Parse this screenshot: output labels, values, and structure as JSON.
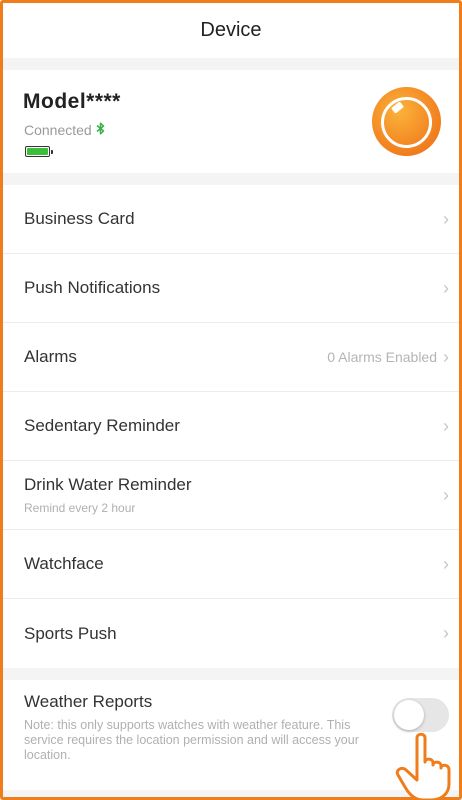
{
  "navbar": {
    "title": "Device"
  },
  "device": {
    "model": "Model****",
    "status": "Connected",
    "bluetooth_icon": "bluetooth-icon",
    "battery_level": 1.0,
    "watch_icon": "watch-icon"
  },
  "menu": {
    "items": [
      {
        "label": "Business Card",
        "sub": "",
        "value": ""
      },
      {
        "label": "Push Notifications",
        "sub": "",
        "value": ""
      },
      {
        "label": "Alarms",
        "sub": "",
        "value": "0 Alarms Enabled"
      },
      {
        "label": "Sedentary Reminder",
        "sub": "",
        "value": ""
      },
      {
        "label": "Drink Water Reminder",
        "sub": "Remind every 2 hour",
        "value": ""
      },
      {
        "label": "Watchface",
        "sub": "",
        "value": ""
      },
      {
        "label": "Sports Push",
        "sub": "",
        "value": ""
      }
    ],
    "chevron": "›"
  },
  "weather": {
    "label": "Weather Reports",
    "note": "Note: this only supports watches with weather feature. This service requires the location permission and will access your location.",
    "enabled": false
  },
  "colors": {
    "accent": "#ef7d1a",
    "battery": "#3bbf3b",
    "bluetooth": "#36b14a"
  }
}
